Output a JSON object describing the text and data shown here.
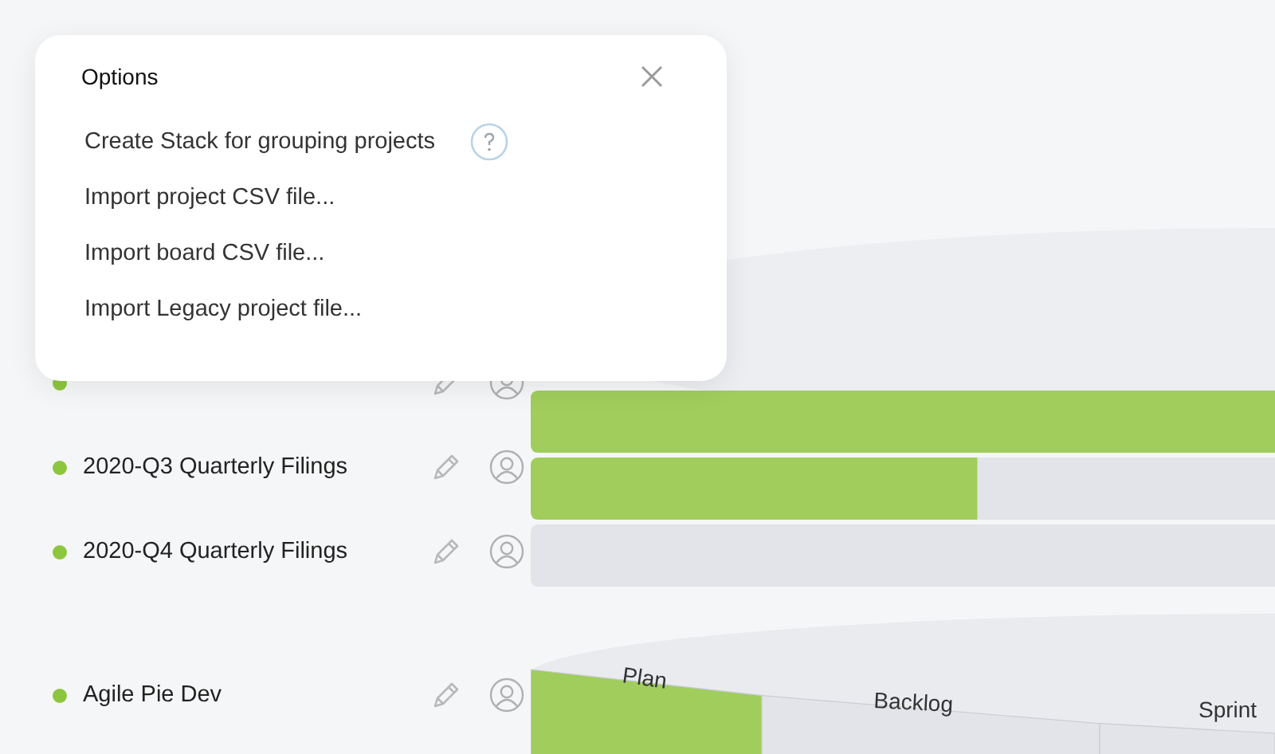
{
  "dialog": {
    "title": "Options",
    "items": [
      {
        "label": "Create Stack for grouping projects",
        "help": true
      },
      {
        "label": "Import project CSV file...",
        "help": false
      },
      {
        "label": "Import board CSV file...",
        "help": false
      },
      {
        "label": "Import Legacy project file...",
        "help": false
      }
    ]
  },
  "projects": [
    {
      "kind": "bar",
      "level": 1
    },
    {
      "name": "2020-Q3 Quarterly Filings",
      "kind": "bar",
      "level": 0.6
    },
    {
      "name": "2020-Q4 Quarterly Filings",
      "kind": "disc"
    },
    {
      "name": "Agile Pie Dev",
      "kind": "stages",
      "stages": [
        {
          "label": "Plan",
          "done": true
        },
        {
          "label": "Backlog",
          "done": false
        },
        {
          "label": "Sprint",
          "done": false
        }
      ]
    }
  ]
}
